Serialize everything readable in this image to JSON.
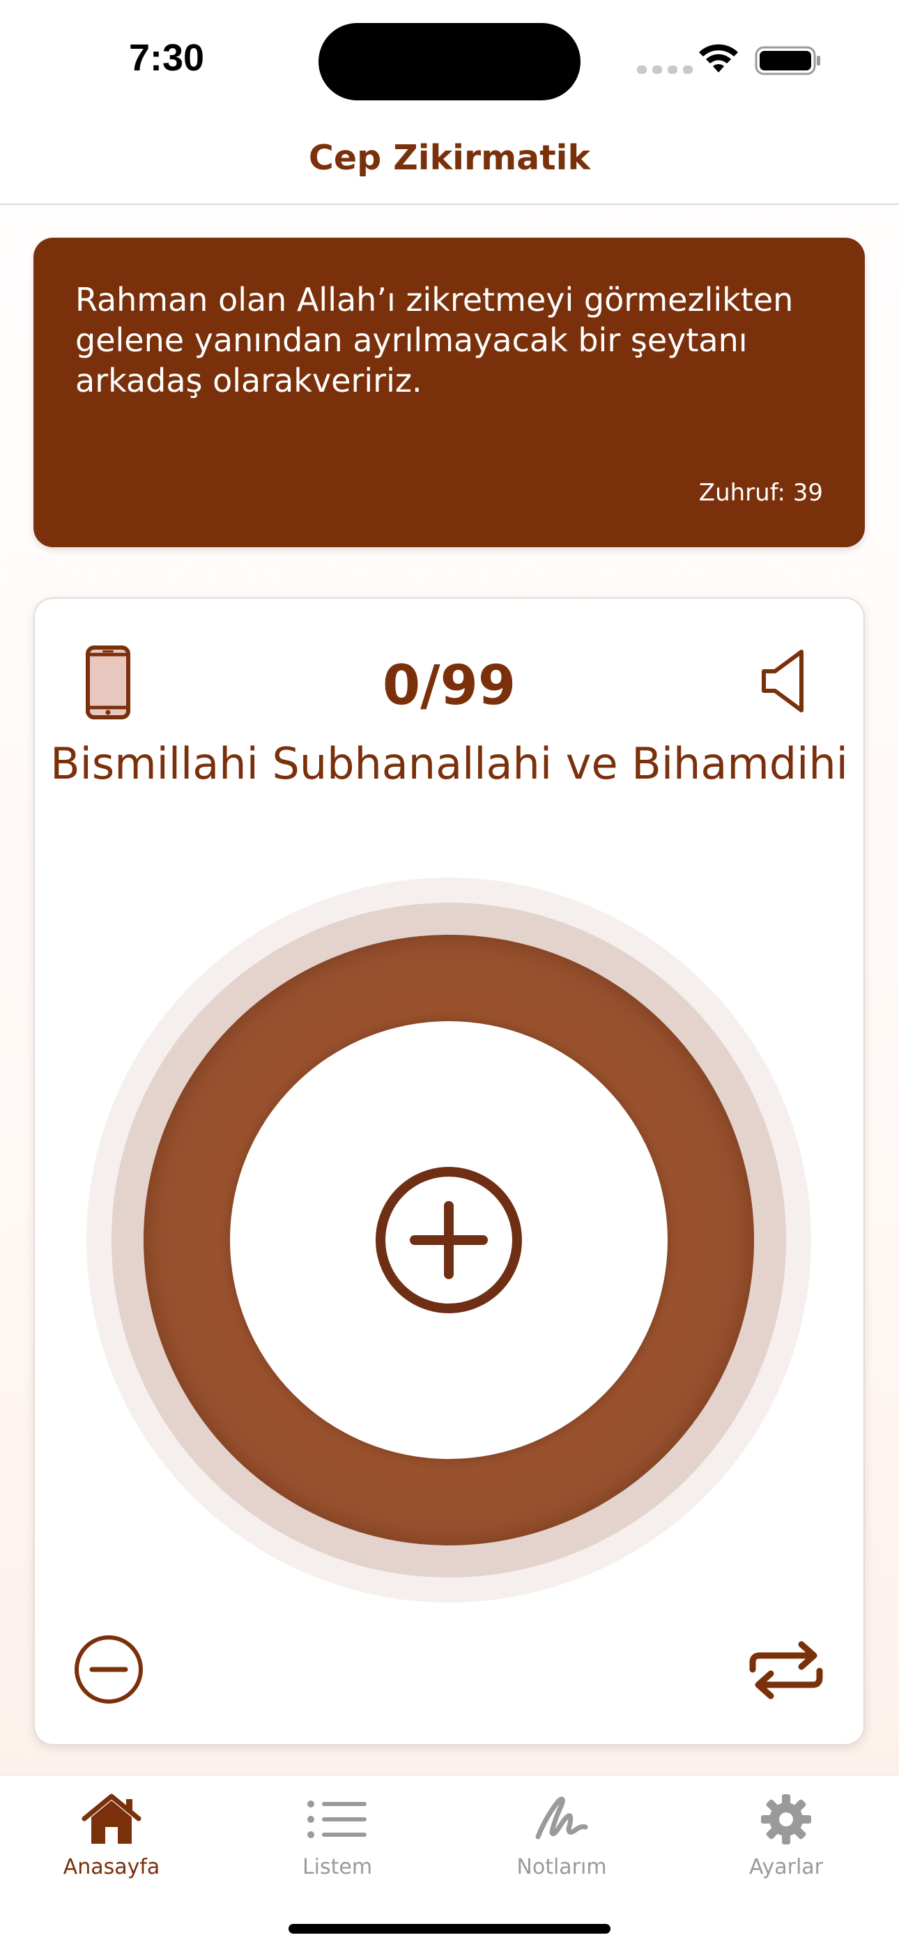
{
  "status_bar": {
    "time": "7:30"
  },
  "header": {
    "title": "Cep Zikirmatik"
  },
  "verse": {
    "text": "Rahman olan Allah’ı zikretmeyi görmezlikten gelene yanından ayrılmayacak bir şeytanı arkadaş olarakveririz.",
    "source": "Zuhruf: 39"
  },
  "counter": {
    "count": "0/99",
    "current": 0,
    "target": 99,
    "dhikr": "Bismillahi Subhanallahi ve Bihamdihi"
  },
  "icons": {
    "vibration": "phone-icon",
    "sound": "speaker-icon",
    "increment": "plus-circle-icon",
    "decrement": "minus-circle-icon",
    "reset": "repeat-icon"
  },
  "tabs": [
    {
      "label": "Anasayfa",
      "icon": "home-icon",
      "active": true
    },
    {
      "label": "Listem",
      "icon": "list-icon",
      "active": false
    },
    {
      "label": "Notlarım",
      "icon": "scribble-icon",
      "active": false
    },
    {
      "label": "Ayarlar",
      "icon": "gear-icon",
      "active": false
    }
  ],
  "colors": {
    "brand": "#7a300b",
    "ring": "#9a522e",
    "inactive_tab": "#9a9a9a"
  }
}
